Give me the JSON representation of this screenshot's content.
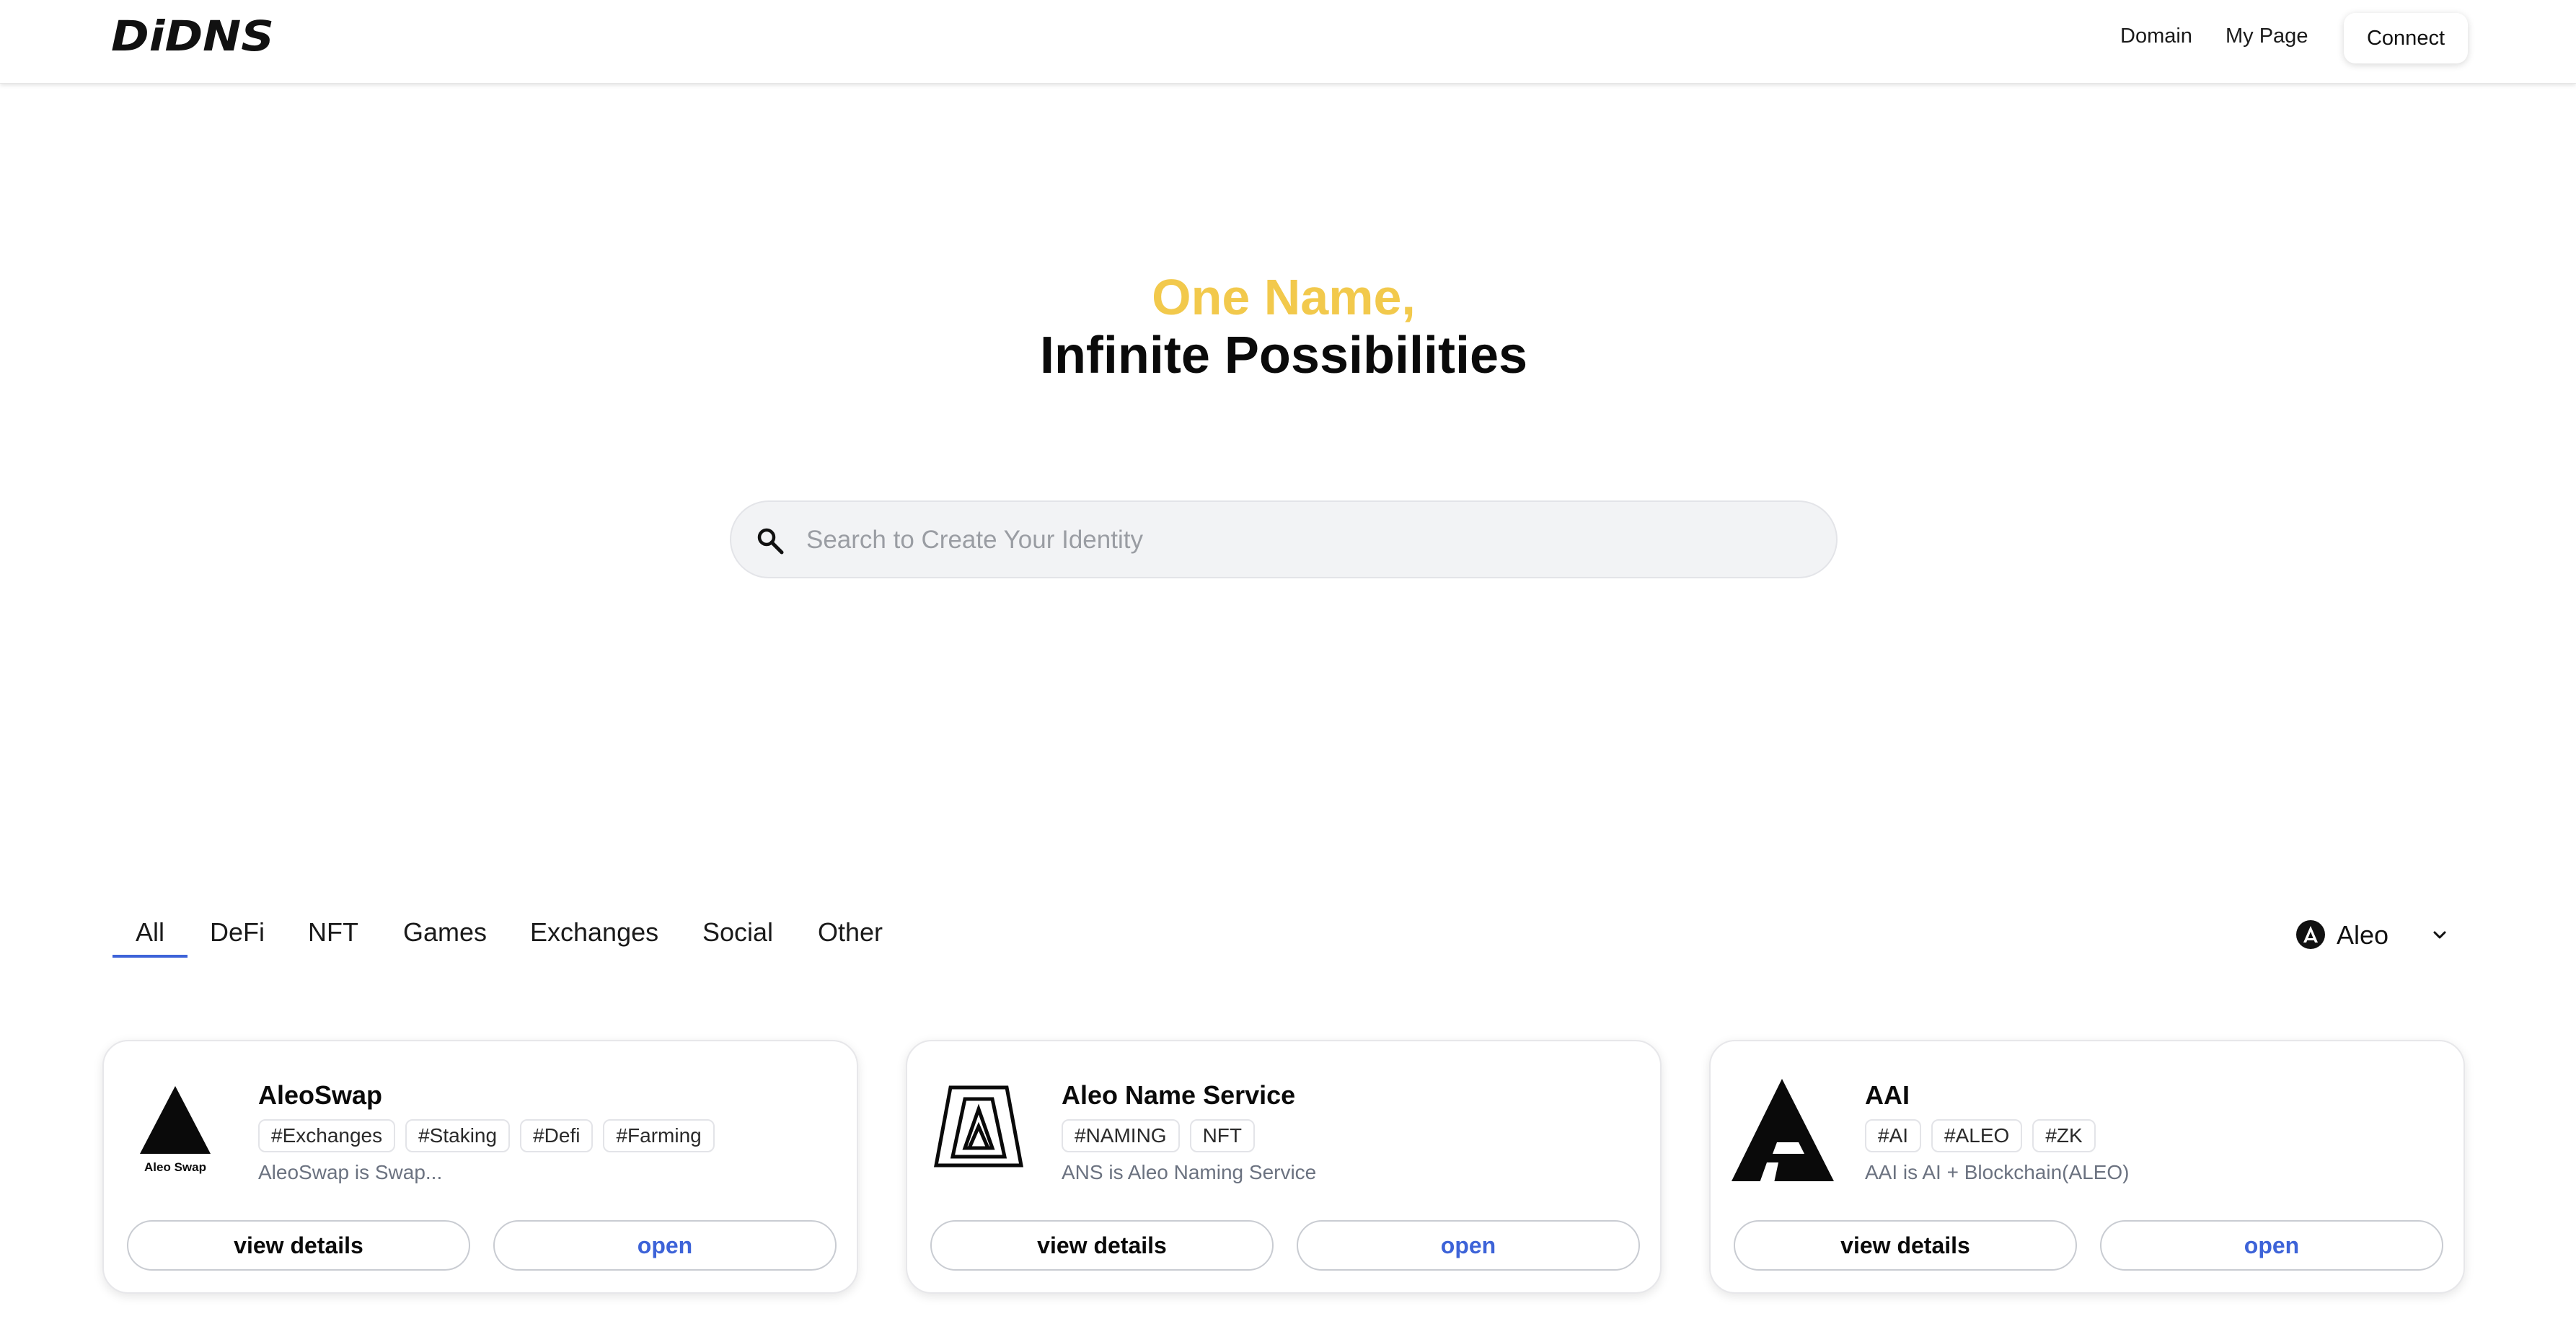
{
  "header": {
    "brand": "DiDNS",
    "nav": {
      "domain": "Domain",
      "my_page": "My Page"
    },
    "connect_label": "Connect"
  },
  "hero": {
    "line1": "One Name,",
    "line2": "Infinite Possibilities",
    "accent_color": "#f2c94c"
  },
  "search": {
    "placeholder": "Search to Create Your Identity",
    "value": "",
    "icon": "search-icon"
  },
  "categories": {
    "tabs": [
      "All",
      "DeFi",
      "NFT",
      "Games",
      "Exchanges",
      "Social",
      "Other"
    ],
    "active": "All",
    "active_color": "#3d63d8"
  },
  "chain": {
    "selected": "Aleo",
    "icon": "aleo-logo-icon"
  },
  "cards": [
    {
      "title": "AleoSwap",
      "logo_text": "Aleo Swap",
      "tags": [
        "#Exchanges",
        "#Staking",
        "#Defi",
        "#Farming"
      ],
      "description": "AleoSwap is Swap...",
      "details_label": "view details",
      "open_label": "open"
    },
    {
      "title": "Aleo Name Service",
      "tags": [
        "#NAMING",
        "NFT"
      ],
      "description": "ANS is Aleo Naming Service",
      "details_label": "view details",
      "open_label": "open"
    },
    {
      "title": "AAI",
      "tags": [
        "#AI",
        "#ALEO",
        "#ZK"
      ],
      "description": "AAI is AI + Blockchain(ALEO)",
      "details_label": "view details",
      "open_label": "open"
    }
  ]
}
